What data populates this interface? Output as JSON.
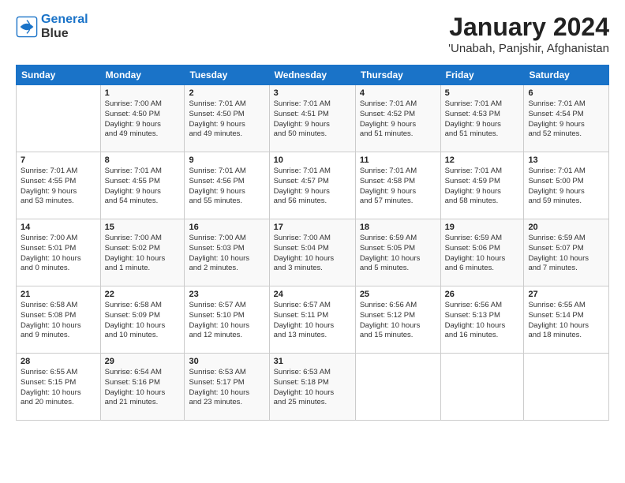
{
  "logo": {
    "line1": "General",
    "line2": "Blue"
  },
  "title": "January 2024",
  "location": "'Unabah, Panjshir, Afghanistan",
  "days_of_week": [
    "Sunday",
    "Monday",
    "Tuesday",
    "Wednesday",
    "Thursday",
    "Friday",
    "Saturday"
  ],
  "weeks": [
    [
      {
        "day": "",
        "sunrise": "",
        "sunset": "",
        "daylight": ""
      },
      {
        "day": "1",
        "sunrise": "Sunrise: 7:00 AM",
        "sunset": "Sunset: 4:50 PM",
        "daylight": "Daylight: 9 hours and 49 minutes."
      },
      {
        "day": "2",
        "sunrise": "Sunrise: 7:01 AM",
        "sunset": "Sunset: 4:50 PM",
        "daylight": "Daylight: 9 hours and 49 minutes."
      },
      {
        "day": "3",
        "sunrise": "Sunrise: 7:01 AM",
        "sunset": "Sunset: 4:51 PM",
        "daylight": "Daylight: 9 hours and 50 minutes."
      },
      {
        "day": "4",
        "sunrise": "Sunrise: 7:01 AM",
        "sunset": "Sunset: 4:52 PM",
        "daylight": "Daylight: 9 hours and 51 minutes."
      },
      {
        "day": "5",
        "sunrise": "Sunrise: 7:01 AM",
        "sunset": "Sunset: 4:53 PM",
        "daylight": "Daylight: 9 hours and 51 minutes."
      },
      {
        "day": "6",
        "sunrise": "Sunrise: 7:01 AM",
        "sunset": "Sunset: 4:54 PM",
        "daylight": "Daylight: 9 hours and 52 minutes."
      }
    ],
    [
      {
        "day": "7",
        "sunrise": "Sunrise: 7:01 AM",
        "sunset": "Sunset: 4:55 PM",
        "daylight": "Daylight: 9 hours and 53 minutes."
      },
      {
        "day": "8",
        "sunrise": "Sunrise: 7:01 AM",
        "sunset": "Sunset: 4:55 PM",
        "daylight": "Daylight: 9 hours and 54 minutes."
      },
      {
        "day": "9",
        "sunrise": "Sunrise: 7:01 AM",
        "sunset": "Sunset: 4:56 PM",
        "daylight": "Daylight: 9 hours and 55 minutes."
      },
      {
        "day": "10",
        "sunrise": "Sunrise: 7:01 AM",
        "sunset": "Sunset: 4:57 PM",
        "daylight": "Daylight: 9 hours and 56 minutes."
      },
      {
        "day": "11",
        "sunrise": "Sunrise: 7:01 AM",
        "sunset": "Sunset: 4:58 PM",
        "daylight": "Daylight: 9 hours and 57 minutes."
      },
      {
        "day": "12",
        "sunrise": "Sunrise: 7:01 AM",
        "sunset": "Sunset: 4:59 PM",
        "daylight": "Daylight: 9 hours and 58 minutes."
      },
      {
        "day": "13",
        "sunrise": "Sunrise: 7:01 AM",
        "sunset": "Sunset: 5:00 PM",
        "daylight": "Daylight: 9 hours and 59 minutes."
      }
    ],
    [
      {
        "day": "14",
        "sunrise": "Sunrise: 7:00 AM",
        "sunset": "Sunset: 5:01 PM",
        "daylight": "Daylight: 10 hours and 0 minutes."
      },
      {
        "day": "15",
        "sunrise": "Sunrise: 7:00 AM",
        "sunset": "Sunset: 5:02 PM",
        "daylight": "Daylight: 10 hours and 1 minute."
      },
      {
        "day": "16",
        "sunrise": "Sunrise: 7:00 AM",
        "sunset": "Sunset: 5:03 PM",
        "daylight": "Daylight: 10 hours and 2 minutes."
      },
      {
        "day": "17",
        "sunrise": "Sunrise: 7:00 AM",
        "sunset": "Sunset: 5:04 PM",
        "daylight": "Daylight: 10 hours and 3 minutes."
      },
      {
        "day": "18",
        "sunrise": "Sunrise: 6:59 AM",
        "sunset": "Sunset: 5:05 PM",
        "daylight": "Daylight: 10 hours and 5 minutes."
      },
      {
        "day": "19",
        "sunrise": "Sunrise: 6:59 AM",
        "sunset": "Sunset: 5:06 PM",
        "daylight": "Daylight: 10 hours and 6 minutes."
      },
      {
        "day": "20",
        "sunrise": "Sunrise: 6:59 AM",
        "sunset": "Sunset: 5:07 PM",
        "daylight": "Daylight: 10 hours and 7 minutes."
      }
    ],
    [
      {
        "day": "21",
        "sunrise": "Sunrise: 6:58 AM",
        "sunset": "Sunset: 5:08 PM",
        "daylight": "Daylight: 10 hours and 9 minutes."
      },
      {
        "day": "22",
        "sunrise": "Sunrise: 6:58 AM",
        "sunset": "Sunset: 5:09 PM",
        "daylight": "Daylight: 10 hours and 10 minutes."
      },
      {
        "day": "23",
        "sunrise": "Sunrise: 6:57 AM",
        "sunset": "Sunset: 5:10 PM",
        "daylight": "Daylight: 10 hours and 12 minutes."
      },
      {
        "day": "24",
        "sunrise": "Sunrise: 6:57 AM",
        "sunset": "Sunset: 5:11 PM",
        "daylight": "Daylight: 10 hours and 13 minutes."
      },
      {
        "day": "25",
        "sunrise": "Sunrise: 6:56 AM",
        "sunset": "Sunset: 5:12 PM",
        "daylight": "Daylight: 10 hours and 15 minutes."
      },
      {
        "day": "26",
        "sunrise": "Sunrise: 6:56 AM",
        "sunset": "Sunset: 5:13 PM",
        "daylight": "Daylight: 10 hours and 16 minutes."
      },
      {
        "day": "27",
        "sunrise": "Sunrise: 6:55 AM",
        "sunset": "Sunset: 5:14 PM",
        "daylight": "Daylight: 10 hours and 18 minutes."
      }
    ],
    [
      {
        "day": "28",
        "sunrise": "Sunrise: 6:55 AM",
        "sunset": "Sunset: 5:15 PM",
        "daylight": "Daylight: 10 hours and 20 minutes."
      },
      {
        "day": "29",
        "sunrise": "Sunrise: 6:54 AM",
        "sunset": "Sunset: 5:16 PM",
        "daylight": "Daylight: 10 hours and 21 minutes."
      },
      {
        "day": "30",
        "sunrise": "Sunrise: 6:53 AM",
        "sunset": "Sunset: 5:17 PM",
        "daylight": "Daylight: 10 hours and 23 minutes."
      },
      {
        "day": "31",
        "sunrise": "Sunrise: 6:53 AM",
        "sunset": "Sunset: 5:18 PM",
        "daylight": "Daylight: 10 hours and 25 minutes."
      },
      {
        "day": "",
        "sunrise": "",
        "sunset": "",
        "daylight": ""
      },
      {
        "day": "",
        "sunrise": "",
        "sunset": "",
        "daylight": ""
      },
      {
        "day": "",
        "sunrise": "",
        "sunset": "",
        "daylight": ""
      }
    ]
  ]
}
